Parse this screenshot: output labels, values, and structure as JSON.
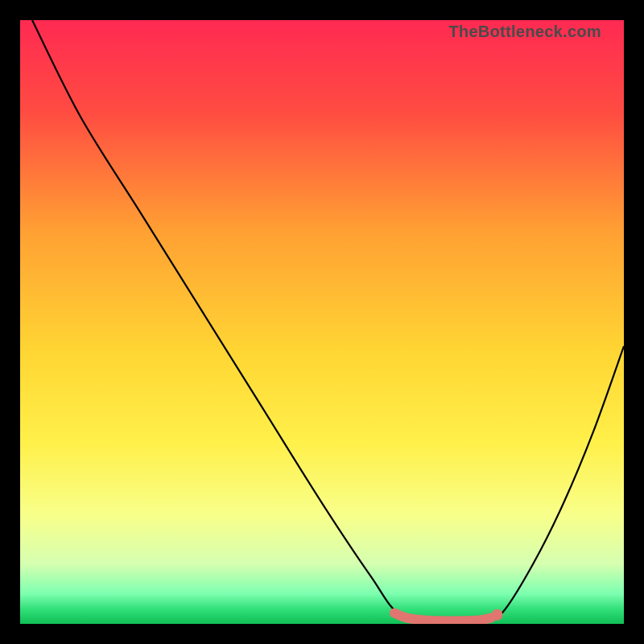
{
  "watermark": "TheBottleneck.com",
  "chart_data": {
    "type": "line",
    "title": "",
    "xlabel": "",
    "ylabel": "",
    "xlim": [
      0,
      100
    ],
    "ylim": [
      0,
      100
    ],
    "gradient_stops": [
      {
        "offset": 0.0,
        "color": "#ff2a52"
      },
      {
        "offset": 0.15,
        "color": "#ff4b42"
      },
      {
        "offset": 0.35,
        "color": "#ffa033"
      },
      {
        "offset": 0.55,
        "color": "#ffd633"
      },
      {
        "offset": 0.7,
        "color": "#fff04a"
      },
      {
        "offset": 0.82,
        "color": "#f8ff8a"
      },
      {
        "offset": 0.9,
        "color": "#d6ffb0"
      },
      {
        "offset": 0.95,
        "color": "#7dffb0"
      },
      {
        "offset": 0.975,
        "color": "#33e07a"
      },
      {
        "offset": 1.0,
        "color": "#0fbf55"
      }
    ],
    "series": [
      {
        "name": "bottleneck-curve",
        "color": "#000000",
        "points": [
          {
            "x": 2,
            "y": 100
          },
          {
            "x": 10,
            "y": 84
          },
          {
            "x": 20,
            "y": 68
          },
          {
            "x": 30,
            "y": 52
          },
          {
            "x": 40,
            "y": 36
          },
          {
            "x": 50,
            "y": 20
          },
          {
            "x": 58,
            "y": 8
          },
          {
            "x": 63,
            "y": 1.5
          },
          {
            "x": 70,
            "y": 0.5
          },
          {
            "x": 77,
            "y": 0.5
          },
          {
            "x": 80,
            "y": 2
          },
          {
            "x": 85,
            "y": 10
          },
          {
            "x": 90,
            "y": 20
          },
          {
            "x": 95,
            "y": 32
          },
          {
            "x": 100,
            "y": 46
          }
        ]
      }
    ],
    "highlight": {
      "color": "#e0766f",
      "points": [
        {
          "x": 62,
          "y": 1.8
        },
        {
          "x": 64,
          "y": 1.0
        },
        {
          "x": 67,
          "y": 0.6
        },
        {
          "x": 70,
          "y": 0.5
        },
        {
          "x": 73,
          "y": 0.5
        },
        {
          "x": 76,
          "y": 0.6
        },
        {
          "x": 78,
          "y": 1.0
        }
      ],
      "end_dot": {
        "x": 79,
        "y": 1.5
      }
    }
  }
}
